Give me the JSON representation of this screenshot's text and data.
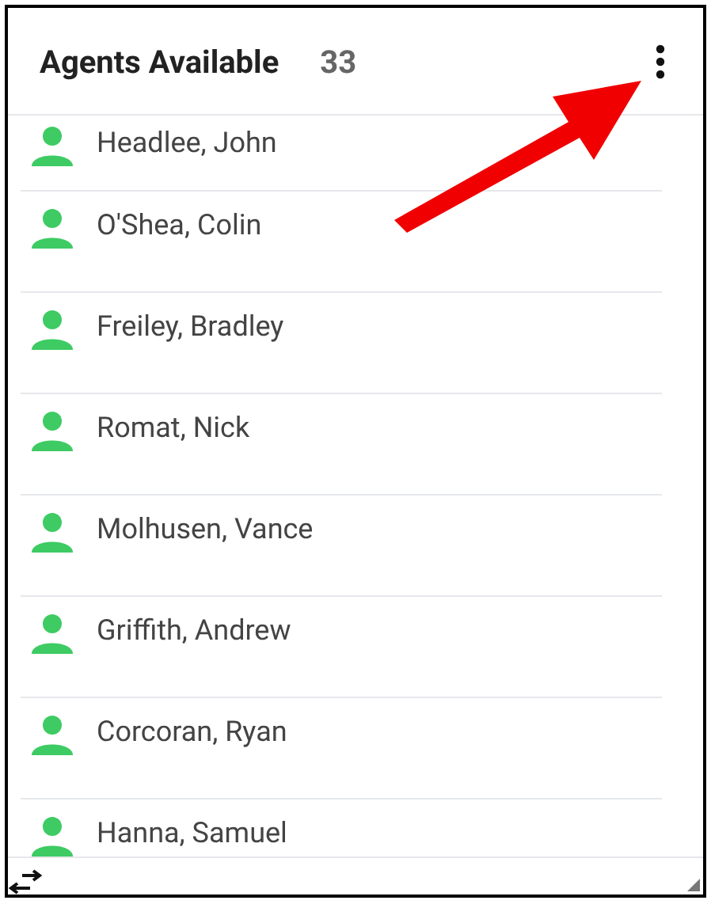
{
  "header": {
    "title": "Agents Available",
    "count": "33"
  },
  "agents": [
    {
      "name": "Headlee, John"
    },
    {
      "name": "O'Shea, Colin"
    },
    {
      "name": "Freiley, Bradley"
    },
    {
      "name": "Romat, Nick"
    },
    {
      "name": "Molhusen, Vance"
    },
    {
      "name": "Griffith, Andrew"
    },
    {
      "name": "Corcoran, Ryan"
    },
    {
      "name": "Hanna, Samuel"
    }
  ]
}
